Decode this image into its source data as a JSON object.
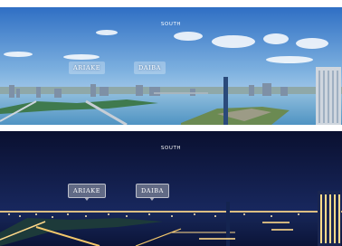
{
  "day_view": {
    "direction_label": "SOUTH",
    "place_labels": [
      {
        "name": "ARIAKE"
      },
      {
        "name": "DAIBA"
      }
    ]
  },
  "night_view": {
    "direction_label": "SOUTH",
    "place_labels": [
      {
        "name": "ARIAKE"
      },
      {
        "name": "DAIBA"
      }
    ]
  },
  "colors": {
    "day_sky_top": "#2f6fc4",
    "day_sky_bottom": "#cfe4f4",
    "water": "#5aa0cc",
    "night_sky_top": "#0a1030",
    "night_sky_bottom": "#1b2d6b",
    "city_lights": "#ffd98a"
  }
}
